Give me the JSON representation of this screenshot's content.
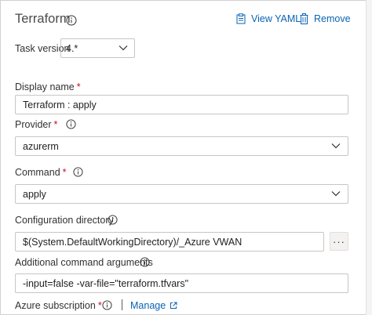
{
  "header": {
    "title": "Terraform",
    "view_yaml": "View YAML",
    "remove": "Remove"
  },
  "task_version": {
    "label": "Task version",
    "value": "4.*"
  },
  "display_name": {
    "label": "Display name",
    "required": "*",
    "value": "Terraform : apply"
  },
  "provider": {
    "label": "Provider",
    "required": "*",
    "value": "azurerm"
  },
  "command": {
    "label": "Command",
    "required": "*",
    "value": "apply"
  },
  "config_dir": {
    "label": "Configuration directory",
    "value": "$(System.DefaultWorkingDirectory)/_Azure VWAN",
    "browse": "···"
  },
  "additional_args": {
    "label": "Additional command arguments",
    "value": "-input=false -var-file=\"terraform.tfvars\""
  },
  "azure_subscription": {
    "label": "Azure subscription",
    "required": "*",
    "manage": "Manage"
  },
  "colors": {
    "link": "#0a63b4",
    "required": "#c50f1f",
    "border": "#c8c6c4"
  }
}
